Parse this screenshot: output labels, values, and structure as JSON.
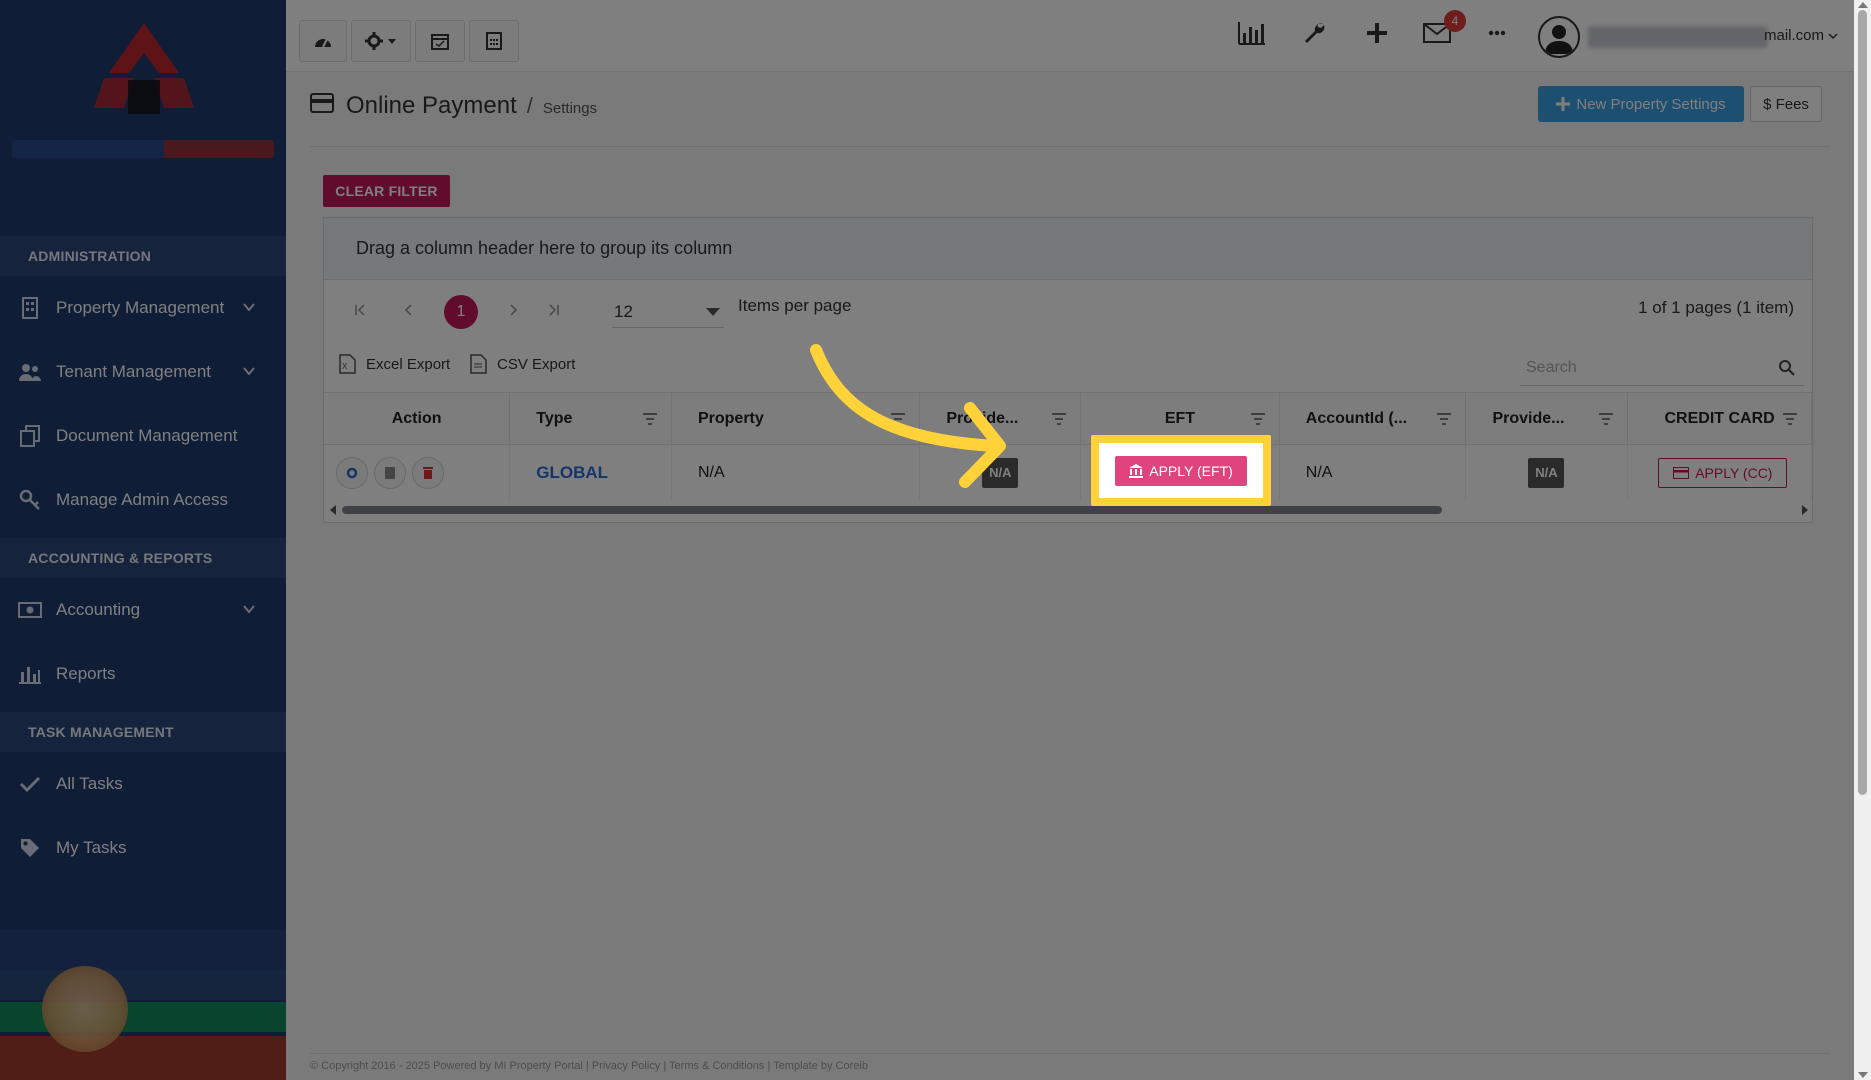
{
  "sidebar": {
    "sections": [
      {
        "title": "ADMINISTRATION",
        "items": [
          {
            "label": "Property Management",
            "expandable": true
          },
          {
            "label": "Tenant Management",
            "expandable": true
          },
          {
            "label": "Document Management",
            "expandable": false
          },
          {
            "label": "Manage Admin Access",
            "expandable": false
          }
        ]
      },
      {
        "title": "ACCOUNTING & REPORTS",
        "items": [
          {
            "label": "Accounting",
            "expandable": true
          },
          {
            "label": "Reports",
            "expandable": false
          }
        ]
      },
      {
        "title": "TASK MANAGEMENT",
        "items": [
          {
            "label": "All Tasks",
            "expandable": false
          },
          {
            "label": "My Tasks",
            "expandable": false
          }
        ]
      }
    ]
  },
  "topbar": {
    "mail_badge": "4",
    "user_email_suffix": "mail.com"
  },
  "page": {
    "title": "Online Payment",
    "breadcrumb_sep": "/",
    "breadcrumb": "Settings",
    "new_property_label": "New Property Settings",
    "fees_label": "$ Fees",
    "clear_filter_label": "CLEAR FILTER"
  },
  "grid": {
    "group_hint": "Drag a column header here to group its column",
    "current_page": "1",
    "page_size": "12",
    "items_per_page_label": "Items per page",
    "page_info": "1 of 1 pages (1 item)",
    "excel_export": "Excel Export",
    "csv_export": "CSV Export",
    "search_placeholder": "Search",
    "columns": [
      "Action",
      "Type",
      "Property",
      "Provide...",
      "EFT",
      "AccountId (...",
      "Provide...",
      "CREDIT CARD"
    ],
    "rows": [
      {
        "type": "GLOBAL",
        "property": "N/A",
        "provider1": "N/A",
        "eft_button": "APPLY (EFT)",
        "account_id": "N/A",
        "provider2": "N/A",
        "cc_button": "APPLY (CC)"
      }
    ]
  },
  "footer": {
    "text": "© Copyright 2016 - 2025 Powered by MI Property Portal | Privacy Policy | Terms & Conditions | Template by Coreib"
  },
  "colors": {
    "sidebar_bg": "#1f3a6e",
    "accent": "#c2185b",
    "primary_btn": "#3b9ee0",
    "highlight": "#ffd23a"
  }
}
